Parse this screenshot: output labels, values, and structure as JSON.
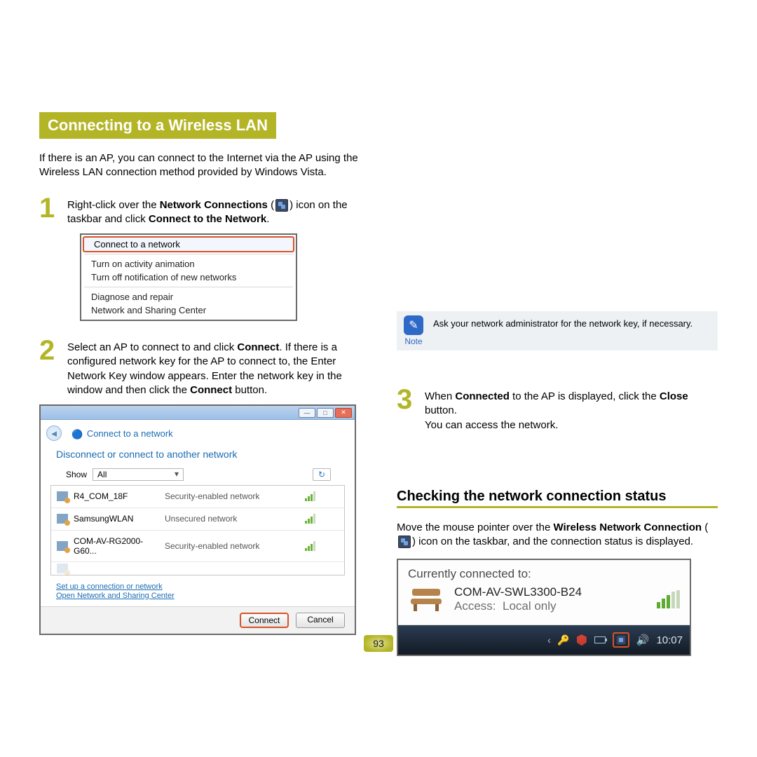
{
  "section_title": "Connecting to a Wireless LAN",
  "intro": "If there is an AP, you can connect to the Internet via the AP using the Wireless LAN connection method provided by Windows Vista.",
  "step1": {
    "num": "1",
    "p1a": "Right-click over the ",
    "p1b": "Network Connections",
    "p1c": " (",
    "p1d": ") icon on the taskbar and click ",
    "p1e": "Connect to the Network",
    "p1f": "."
  },
  "context_menu": {
    "highlight": "Connect to a network",
    "items_a": [
      "Turn on activity animation",
      "Turn off notification of new networks"
    ],
    "items_b": [
      "Diagnose and repair",
      "Network and Sharing Center"
    ]
  },
  "step2": {
    "num": "2",
    "p1a": "Select an AP to connect to and click ",
    "p1b": "Connect",
    "p1c": ". If there is a configured network key for the AP to connect to, the Enter Network Key window appears. Enter the network key in the window and then click the ",
    "p1d": "Connect",
    "p1e": " button."
  },
  "dialog": {
    "title": "Connect to a network",
    "heading": "Disconnect or connect to another network",
    "show_label": "Show",
    "show_value": "All",
    "networks": [
      {
        "name": "R4_COM_18F",
        "sec": "Security-enabled network"
      },
      {
        "name": "SamsungWLAN",
        "sec": "Unsecured network"
      },
      {
        "name": "COM-AV-RG2000-G60...",
        "sec": "Security-enabled network"
      }
    ],
    "links": [
      "Set up a connection or network",
      "Open Network and Sharing Center"
    ],
    "connect": "Connect",
    "cancel": "Cancel"
  },
  "note": {
    "label": "Note",
    "body": "Ask your network administrator for the network key, if necessary."
  },
  "step3": {
    "num": "3",
    "l1a": "When ",
    "l1b": "Connected",
    "l1c": " to the AP is displayed, click the ",
    "l1d": "Close",
    "l1e": " button.",
    "l2": "You can access the network."
  },
  "subsection_title": "Checking the network connection status",
  "para2a": "Move the mouse pointer over the ",
  "para2b": "Wireless Network Connection",
  "para2c": " (",
  "para2d": ") icon on the taskbar, and the connection status is displayed.",
  "tooltip": {
    "label": "Currently connected to:",
    "name": "COM-AV-SWL3300-B24",
    "access_label": "Access:",
    "access_value": "Local only",
    "clock": "10:07"
  },
  "page_number": "93"
}
